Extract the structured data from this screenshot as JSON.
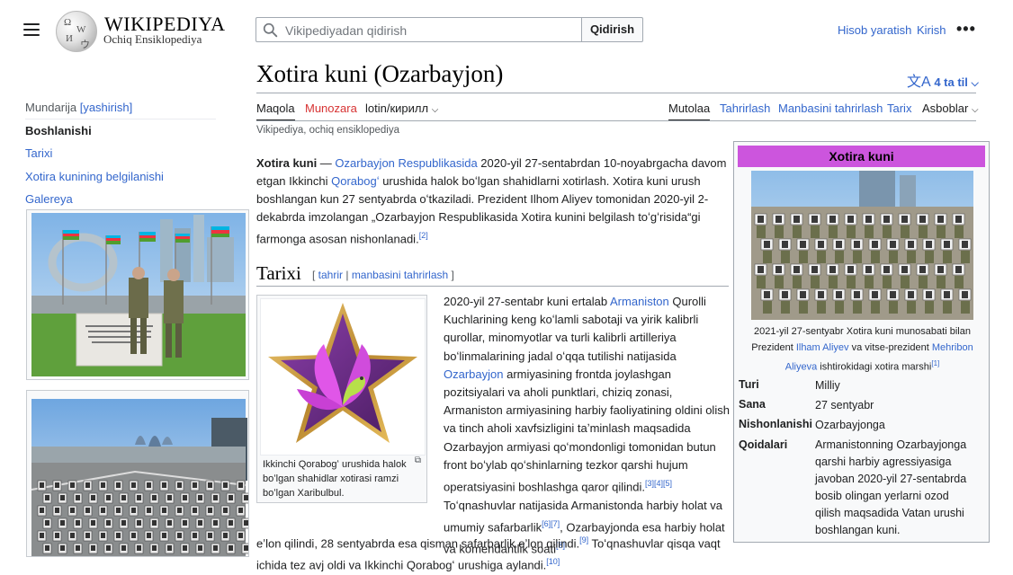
{
  "header": {
    "wordmark": "WIKIPEDIYA",
    "tagline": "Ochiq Ensiklopediya",
    "search_placeholder": "Vikipediyadan qidirish",
    "search_button": "Qidirish",
    "create_account": "Hisob yaratish",
    "login": "Kirish",
    "more": "•••"
  },
  "toc": {
    "heading": "Mundarija",
    "hide": "[yashirish]",
    "items": [
      "Boshlanishi",
      "Tarixi",
      "Xotira kunining belgilanishi",
      "Galereya"
    ]
  },
  "page": {
    "title": "Xotira kuni (Ozarbayjon)",
    "languages": "4 ta til",
    "tabs_left": [
      "Maqola",
      "Munozara",
      "lotin/кирилл"
    ],
    "tabs_right": [
      "Mutolaa",
      "Tahrirlash",
      "Manbasini tahrirlash",
      "Tarix",
      "Asboblar"
    ],
    "from": "Vikipediya, ochiq ensiklopediya"
  },
  "intro": {
    "bold": "Xotira kuni",
    "dash": " — ",
    "link1": "Ozarbayjon Respublikasida",
    "t1": " 2020-yil 27-sentabrdan 10-noyabrgacha davom etgan Ikkinchi ",
    "link2": "Qorabogʻ",
    "t2": " urushida halok boʻlgan shahidlarni xotirlash. Xotira kuni urush boshlangan kun 27 sentyabrda oʻtkaziladi. Prezident Ilhom Aliyev tomonidan 2020-yil 2-dekabrda imzolangan „Ozarbayjon Respublikasida Xotira kunini belgilash toʻgʻrisida“gi farmonga asosan nishonlanadi.",
    "ref": "[2]"
  },
  "section": {
    "title": "Tarixi",
    "edit_open": "[ ",
    "edit": "tahrir",
    "sep": " | ",
    "edit_source": "manbasini tahrirlash",
    "edit_close": " ]"
  },
  "thumb": {
    "caption": "Ikkinchi Qorabogʻ urushida halok boʻlgan shahidlar xotirasi ramzi boʻlgan Xaribulbul."
  },
  "history": {
    "t1": "2020-yil 27-sentabr kuni ertalab ",
    "link1": "Armaniston",
    "t2": " Qurolli Kuchlarining keng koʻlamli sabotaji va yirik kalibrli qurollar, minomyotlar va turli kalibrli artilleriya boʻlinmalarining jadal oʻqqa tutilishi natijasida ",
    "link2": "Ozarbayjon",
    "t3": " armiyasining frontda joylashgan pozitsiyalari va aholi punktlari, chiziq zonasi, Armaniston armiyasining harbiy faoliyatining oldini olish va tinch aholi xavfsizligini taʼminlash maqsadida Ozarbayjon armiyasi qoʻmondonligi tomonidan butun front boʻylab qoʻshinlarning tezkor qarshi hujum operatsiyasini boshlashga qaror qilindi.",
    "ref1": "[3][4][5]",
    "t4": " Toʻqnashuvlar natijasida Armanistonda harbiy holat va umumiy safarbarlik",
    "ref2": "[6][7]",
    "t5": ", Ozarbayjonda esa harbiy holat va komendantlik soati",
    "ref3": "[8]",
    "t6": " eʼlon qilindi, 28 sentyabrda esa qisman safarbarlik eʼlon qilindi.",
    "ref4": "[9]",
    "t7": " Toʻqnashuvlar qisqa vaqt ichida tez avj oldi va Ikkinchi Qorabogʻ urushiga aylandi.",
    "ref5": "[10]"
  },
  "infobox": {
    "title": "Xotira kuni",
    "cap_t1": "2021-yil 27-sentyabr Xotira kuni munosabati bilan Prezident ",
    "cap_link1": "Ilham Aliyev",
    "cap_t2": " va vitse-prezident ",
    "cap_link2": "Mehribon Aliyeva",
    "cap_t3": " ishtirokidagi xotira marshi",
    "cap_ref": "[1]",
    "rows": [
      {
        "label": "Turi",
        "value": "Milliy"
      },
      {
        "label": "Sana",
        "value": "27 sentyabr"
      },
      {
        "label": "Nishonlanishi",
        "value": "Ozarbayjonga"
      },
      {
        "label": "Qoidalari",
        "value": "Armanistonning Ozarbayjonga qarshi harbiy agressiyasiga javoban 2020-yil 27-sentabrda bosib olingan yerlarni ozod qilish maqsadida Vatan urushi boshlangan kuni."
      }
    ]
  },
  "colors": {
    "link": "#3366cc",
    "red_link": "#d73333",
    "infobox_title": "#cc55dd"
  }
}
